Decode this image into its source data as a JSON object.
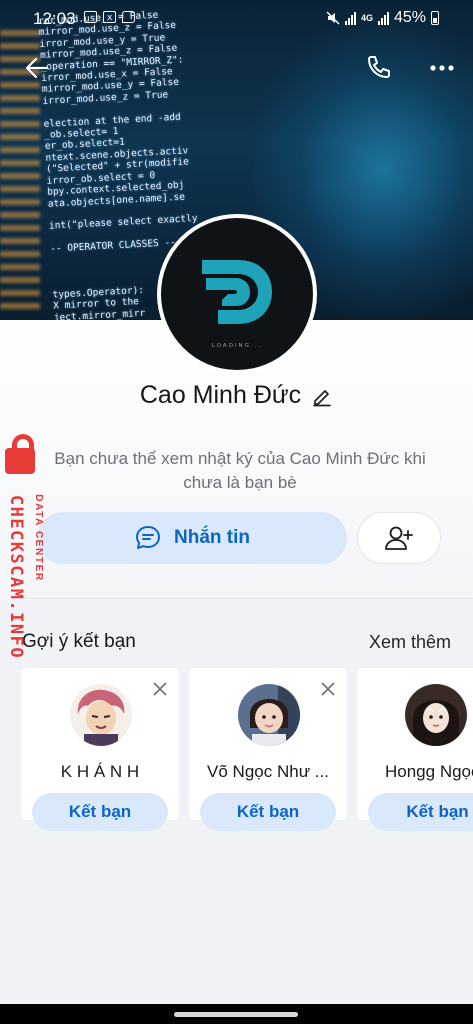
{
  "status_bar": {
    "time": "12:03",
    "battery": "45%",
    "network_label": "4G"
  },
  "header": {
    "back_icon": "arrow-left-icon",
    "call_icon": "phone-icon",
    "more_icon": "more-horizontal-icon"
  },
  "cover": {
    "code_lines": [
      "ror_mod.use_x = False",
      "mirror_mod.use_z = False",
      "irror_mod.use_y = True",
      "mirror_mod.use_z = False",
      "_operation == \"MIRROR_Z\":",
      "irror_mod.use_x = False",
      "mirror_mod.use_y = False",
      "irror_mod.use_z = True",
      "",
      "election at the end -add",
      "_ob.select= 1",
      "er_ob.select=1",
      "ntext.scene.objects.activ",
      "(\"Selected\" + str(modifie",
      "irror_ob.select = 0",
      "bpy.context.selected_obj",
      "ata.objects[one.name].se",
      "",
      "int(\"please select exactly",
      "",
      "-- OPERATOR CLASSES --",
      "",
      "",
      "",
      "types.Operator):",
      "X mirror to the",
      "ject.mirror_mirr"
    ]
  },
  "profile": {
    "avatar_caption": "LOADING...",
    "name": "Cao Minh Đức",
    "edit_icon": "pencil-icon",
    "notice": "Bạn chưa thể xem nhật ký của Cao Minh Đức khi chưa là bạn bè",
    "message_button": "Nhắn tin",
    "message_icon": "chat-bubble-icon",
    "add_friend_icon": "add-user-icon"
  },
  "suggestions": {
    "title": "Gợi ý kết bạn",
    "see_more": "Xem thêm",
    "items": [
      {
        "name": "K H Á N H",
        "action": "Kết bạn",
        "dismissible": true
      },
      {
        "name": "Võ Ngọc Như ...",
        "action": "Kết bạn",
        "dismissible": true
      },
      {
        "name": "Hongg Ngọc",
        "action": "Kết bạn",
        "dismissible": false
      }
    ]
  },
  "watermark": {
    "brand": "CHECKSCAM.INFO",
    "subtitle": "DATA CENTER"
  },
  "colors": {
    "accent": "#0d64c8",
    "button_bg": "#d9e9fb",
    "watermark": "#e63b36",
    "logo": "#1fa3b8"
  }
}
